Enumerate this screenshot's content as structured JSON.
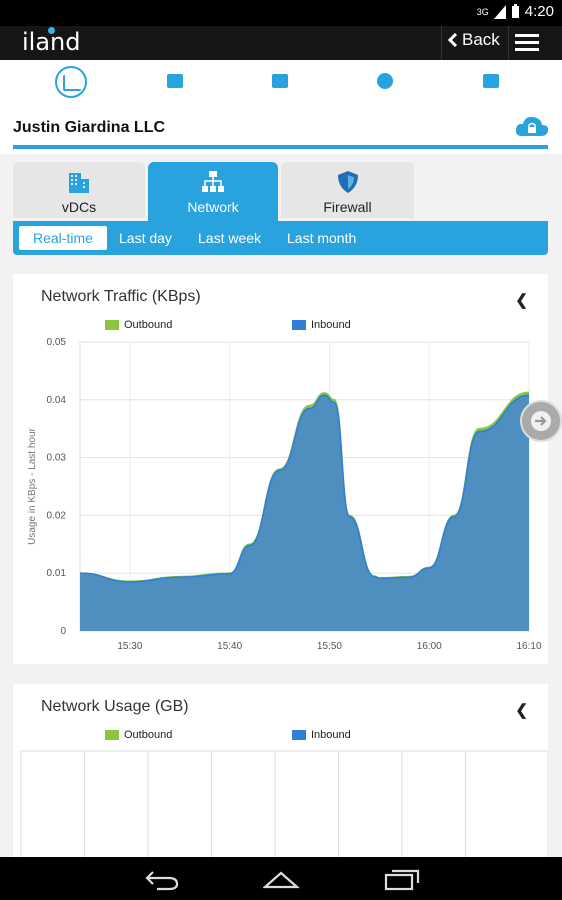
{
  "status_bar": {
    "network": "3G",
    "time": "4:20"
  },
  "app_bar": {
    "logo": "iland",
    "back_label": "Back"
  },
  "icon_bar": {
    "items": [
      {
        "icon": "bar-chart-icon",
        "active": true
      },
      {
        "icon": "billing-icon",
        "active": false
      },
      {
        "icon": "message-icon",
        "active": false
      },
      {
        "icon": "globe-icon",
        "active": false
      },
      {
        "icon": "alert-icon",
        "active": false
      }
    ]
  },
  "company": {
    "name": "Justin Giardina LLC"
  },
  "tabs": [
    {
      "label": "vDCs",
      "icon": "building-icon",
      "active": false
    },
    {
      "label": "Network",
      "icon": "network-icon",
      "active": true
    },
    {
      "label": "Firewall",
      "icon": "shield-icon",
      "active": false
    }
  ],
  "ranges": [
    "Real-time",
    "Last day",
    "Last week",
    "Last month"
  ],
  "selected_range": "Real-time",
  "colors": {
    "accent": "#29a3dd",
    "outbound": "#8cc63f",
    "inbound": "#2f7ed8",
    "fill": "#4f8fbf"
  },
  "chart_data": [
    {
      "type": "area",
      "title": "Network Traffic (KBps)",
      "ylabel": "Usage in KBps - Last hour",
      "xlabel": "",
      "ylim": [
        0,
        0.05
      ],
      "yticks": [
        "0.05",
        "0.04",
        "0.03",
        "0.02",
        "0.01",
        "0"
      ],
      "xticks": [
        "15:30",
        "15:40",
        "15:50",
        "16:00",
        "16:10"
      ],
      "legend": [
        "Outbound",
        "Inbound"
      ],
      "legend_position": "top",
      "grid": true,
      "x": [
        0,
        5,
        10,
        15,
        17,
        20,
        23,
        24.5,
        25.5,
        27,
        29.5,
        30,
        33,
        35,
        37.5,
        40,
        45
      ],
      "series": [
        {
          "name": "Outbound",
          "values": [
            0.01,
            0.0086,
            0.0094,
            0.01,
            0.015,
            0.028,
            0.039,
            0.0412,
            0.04,
            0.02,
            0.0095,
            0.0092,
            0.0094,
            0.011,
            0.02,
            0.035,
            0.0413
          ]
        },
        {
          "name": "Inbound",
          "values": [
            0.01,
            0.0085,
            0.0093,
            0.0099,
            0.0148,
            0.0278,
            0.0385,
            0.0408,
            0.0395,
            0.0198,
            0.0094,
            0.0091,
            0.0093,
            0.0109,
            0.0198,
            0.0345,
            0.0408
          ]
        }
      ]
    },
    {
      "type": "bar",
      "title": "Network Usage (GB)",
      "legend": [
        "Outbound",
        "Inbound"
      ],
      "legend_position": "top",
      "grid": true
    }
  ]
}
